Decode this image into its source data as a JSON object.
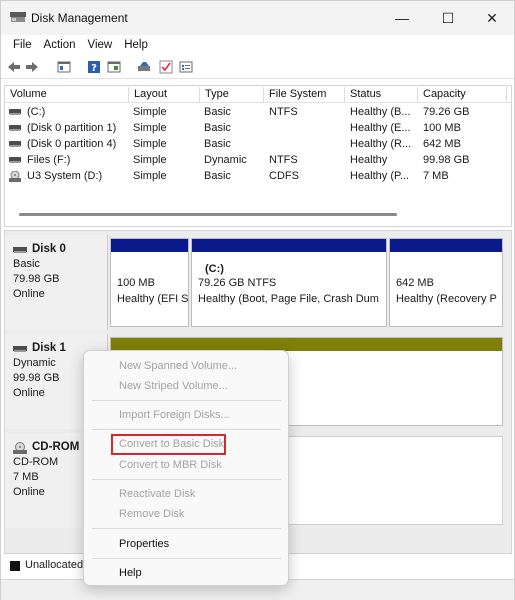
{
  "window": {
    "title": "Disk Management",
    "min_glyph": "—",
    "max_glyph": "☐",
    "close_glyph": "✕"
  },
  "menu": [
    "File",
    "Action",
    "View",
    "Help"
  ],
  "toolbar": {
    "icons": [
      "back-arrow-icon",
      "forward-arrow-icon",
      "console-tree-icon",
      "help-icon",
      "properties-icon",
      "disk-icon",
      "check-icon",
      "list-icon"
    ]
  },
  "volume_list": {
    "headers": [
      "Volume",
      "Layout",
      "Type",
      "File System",
      "Status",
      "Capacity"
    ],
    "rows": [
      {
        "volume": "(C:)",
        "layout": "Simple",
        "type": "Basic",
        "fs": "NTFS",
        "status": "Healthy (B...",
        "capacity": "79.26 GB",
        "icon": "drive-icon"
      },
      {
        "volume": "(Disk 0 partition 1)",
        "layout": "Simple",
        "type": "Basic",
        "fs": "",
        "status": "Healthy (E...",
        "capacity": "100 MB",
        "icon": "drive-icon"
      },
      {
        "volume": "(Disk 0 partition 4)",
        "layout": "Simple",
        "type": "Basic",
        "fs": "",
        "status": "Healthy (R...",
        "capacity": "642 MB",
        "icon": "drive-icon"
      },
      {
        "volume": "Files (F:)",
        "layout": "Simple",
        "type": "Dynamic",
        "fs": "NTFS",
        "status": "Healthy",
        "capacity": "99.98 GB",
        "icon": "drive-icon"
      },
      {
        "volume": "U3 System (D:)",
        "layout": "Simple",
        "type": "Basic",
        "fs": "CDFS",
        "status": "Healthy (P...",
        "capacity": "7 MB",
        "icon": "cdrom-icon"
      }
    ]
  },
  "disks": {
    "disk0": {
      "name": "Disk 0",
      "type": "Basic",
      "size": "79.98 GB",
      "state": "Online",
      "partitions": {
        "p1": {
          "line1": "100 MB",
          "line2": "Healthy (EFI S"
        },
        "p2": {
          "title": "(C:)",
          "line1": "79.26 GB NTFS",
          "line2": "Healthy (Boot, Page File, Crash Dum"
        },
        "p3": {
          "line1": "642 MB",
          "line2": "Healthy (Recovery P"
        }
      }
    },
    "disk1": {
      "name": "Disk 1",
      "type": "Dynamic",
      "size": "99.98 GB",
      "state": "Online"
    },
    "cdrom": {
      "name": "CD-ROM",
      "type": "CD-ROM",
      "size": "7 MB",
      "state": "Online"
    }
  },
  "legend": {
    "unallocated": "Unallocated"
  },
  "context_menu": {
    "new_spanned": "New Spanned Volume...",
    "new_striped": "New Striped Volume...",
    "import_foreign": "Import Foreign Disks...",
    "convert_basic": "Convert to Basic Disk",
    "convert_mbr": "Convert to MBR Disk",
    "reactivate": "Reactivate Disk",
    "remove": "Remove Disk",
    "properties": "Properties",
    "help": "Help"
  },
  "colors": {
    "partition_blue": "#0a1a8c",
    "dynamic_olive": "#7f7f0a",
    "highlight_red": "#d22a2a"
  }
}
